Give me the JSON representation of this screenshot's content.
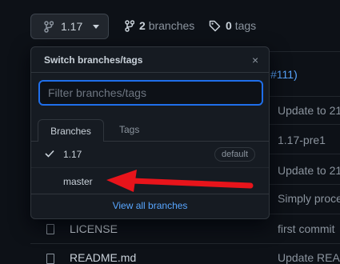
{
  "branch_button": {
    "label": "1.17"
  },
  "branches_link": {
    "count": "2",
    "label": "branches"
  },
  "tags_link": {
    "count": "0",
    "label": "tags"
  },
  "background_rows": [
    {
      "right": "#111)"
    },
    {
      "right": "Update to 21"
    },
    {
      "right": "1.17-pre1"
    },
    {
      "right": "Update to 21"
    },
    {
      "right": "Simply proce"
    }
  ],
  "files": [
    {
      "name": "LICENSE",
      "message": "first commit"
    },
    {
      "name": "README.md",
      "message": "Update REA"
    }
  ],
  "dropdown": {
    "title": "Switch branches/tags",
    "close": "×",
    "filter_placeholder": "Filter branches/tags",
    "tabs": {
      "branches": "Branches",
      "tags": "Tags"
    },
    "items": [
      {
        "label": "1.17",
        "selected": true,
        "badge": "default"
      },
      {
        "label": "master",
        "selected": false
      }
    ],
    "view_all": "View all branches"
  },
  "colors": {
    "accent": "#1f6feb",
    "link": "#58a6ff",
    "arrow": "#e8141b",
    "background": "#0d1117"
  }
}
